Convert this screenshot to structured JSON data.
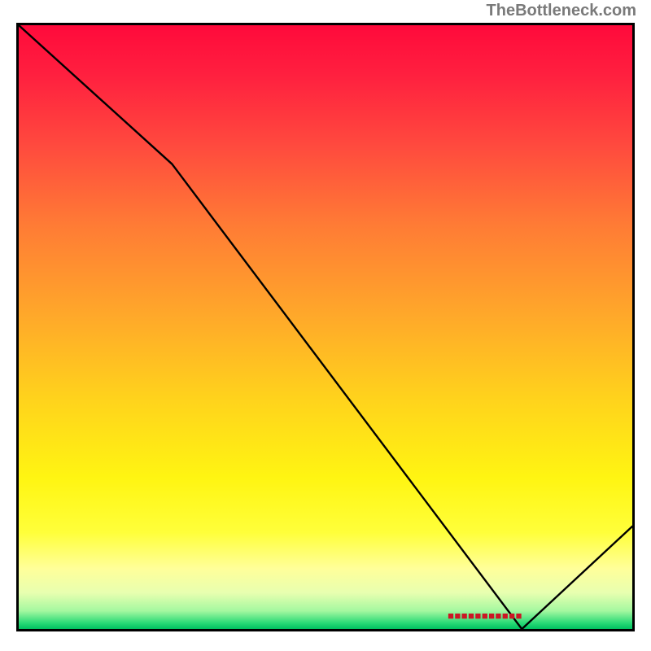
{
  "attribution": "TheBottleneck.com",
  "chart_data": {
    "type": "line",
    "x": [
      0,
      25,
      82,
      100
    ],
    "values": [
      100,
      77,
      0,
      17
    ],
    "xlabel": "",
    "ylabel": "",
    "xlim": [
      0,
      100
    ],
    "ylim": [
      0,
      100
    ],
    "grid": false,
    "gradient_bands": [
      {
        "pos": 0.0,
        "color": "#ff0a3b"
      },
      {
        "pos": 0.5,
        "color": "#ffb020"
      },
      {
        "pos": 0.8,
        "color": "#ffff40"
      },
      {
        "pos": 1.0,
        "color": "#00c060"
      }
    ],
    "annotations": [
      {
        "text": "■■■■■■■■■■■",
        "x": 76,
        "y": 1
      }
    ]
  }
}
